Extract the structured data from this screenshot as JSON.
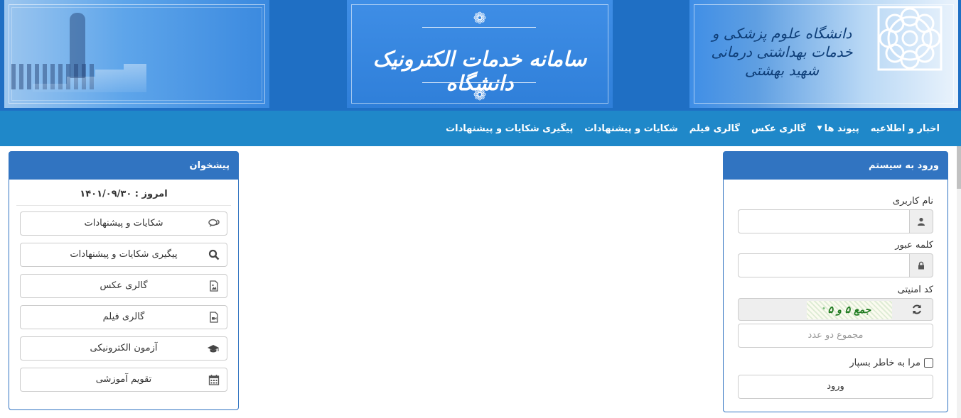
{
  "banner": {
    "system_title": "سامانه خدمات الکترونیک دانشگاه",
    "university_name": "دانشگاه علوم پزشکی و خدمات بهداشتی درمانی شهید بهشتی"
  },
  "nav": {
    "items": [
      {
        "label": "اخبار و اطلاعیه"
      },
      {
        "label": "پیوند ها",
        "has_dropdown": true
      },
      {
        "label": "گالری عکس"
      },
      {
        "label": "گالری فیلم"
      },
      {
        "label": "شکایات و پیشنهادات"
      },
      {
        "label": "پیگیری شکایات و پیشنهادات"
      }
    ]
  },
  "login": {
    "title": "ورود به سیستم",
    "username_label": "نام کاربری",
    "username_value": "",
    "password_label": "کلمه عبور",
    "password_value": "",
    "captcha_label": "کد امنیتی",
    "captcha_image_text": "جمع ۵ و ۵",
    "sum_placeholder": "مجموع دو عدد",
    "remember_label": "مرا به خاطر بسپار",
    "remember_checked": false,
    "submit_label": "ورود"
  },
  "pishkhan": {
    "title": "پیشخوان",
    "today": "امروز : ۱۴۰۱/۰۹/۳۰",
    "buttons": [
      {
        "label": "شکایات و پیشنهادات",
        "icon": "comments-icon"
      },
      {
        "label": "پیگیری شکایات و پیشنهادات",
        "icon": "search-icon"
      },
      {
        "label": "گالری عکس",
        "icon": "image-file-icon"
      },
      {
        "label": "گالری فیلم",
        "icon": "video-file-icon"
      },
      {
        "label": "آزمون الکترونیکی",
        "icon": "graduation-cap-icon"
      },
      {
        "label": "تقویم آموزشی",
        "icon": "calendar-icon"
      }
    ]
  },
  "colors": {
    "banner": "#1f6fc4",
    "navbar": "#1f88c9",
    "panel_header": "#3174c1",
    "captcha_text": "#1f7a1f"
  }
}
